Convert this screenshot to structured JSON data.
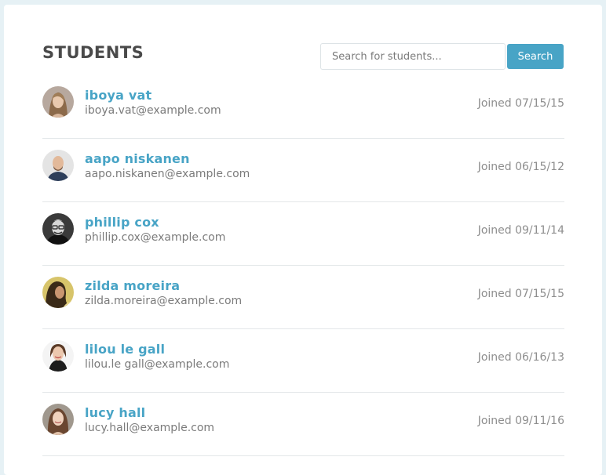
{
  "header": {
    "title": "STUDENTS",
    "search_placeholder": "Search for students...",
    "search_button_label": "Search"
  },
  "colors": {
    "accent": "#48a4c6",
    "title_text": "#4a4a4a",
    "muted_text": "#7b7b7b",
    "background": "#e6f1f5"
  },
  "students": [
    {
      "name": "iboya vat",
      "email": "iboya.vat@example.com",
      "joined": "Joined 07/15/15",
      "avatar_icon": "woman-portrait-avatar"
    },
    {
      "name": "aapo niskanen",
      "email": "aapo.niskanen@example.com",
      "joined": "Joined 06/15/12",
      "avatar_icon": "man-portrait-avatar"
    },
    {
      "name": "phillip cox",
      "email": "phillip.cox@example.com",
      "joined": "Joined 09/11/14",
      "avatar_icon": "man-glasses-portrait-avatar"
    },
    {
      "name": "zilda moreira",
      "email": "zilda.moreira@example.com",
      "joined": "Joined 07/15/15",
      "avatar_icon": "woman-portrait-avatar"
    },
    {
      "name": "lilou le gall",
      "email": "lilou.le gall@example.com",
      "joined": "Joined 06/16/13",
      "avatar_icon": "woman-portrait-avatar"
    },
    {
      "name": "lucy hall",
      "email": "lucy.hall@example.com",
      "joined": "Joined 09/11/16",
      "avatar_icon": "woman-portrait-avatar"
    }
  ]
}
